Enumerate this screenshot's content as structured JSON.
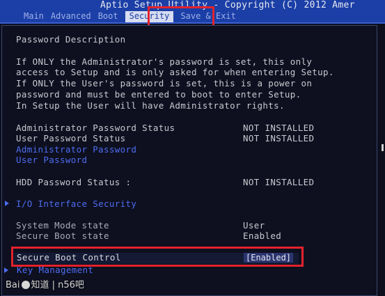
{
  "app": {
    "title": "Aptio Setup Utility - Copyright (C) 2012 Amer"
  },
  "tabs": [
    {
      "label": "Main",
      "active": false
    },
    {
      "label": "Advanced",
      "active": false
    },
    {
      "label": "Boot",
      "active": false
    },
    {
      "label": "Security",
      "active": true
    },
    {
      "label": "Save & Exit",
      "active": false
    }
  ],
  "security": {
    "section_title": "Password Description",
    "description_lines": [
      "If ONLY the Administrator's password is set, this only",
      "access to Setup and is only asked for when entering Setup.",
      "If ONLY the User's password is set, this is a power on",
      "password and must be entered to boot to enter Setup.",
      "In Setup the User will have Administrator rights."
    ],
    "admin_status_label": "Administrator Password Status",
    "admin_status_value": "NOT INSTALLED",
    "user_status_label": "User Password Status",
    "user_status_value": "NOT INSTALLED",
    "admin_password_link": "Administrator Password",
    "user_password_link": "User Password",
    "hdd_status_label": "HDD Password Status  :",
    "hdd_status_value": "NOT INSTALLED",
    "io_security_label": "I/O Interface Security",
    "system_mode_label": "System Mode state",
    "system_mode_value": "User",
    "secure_boot_state_label": "Secure Boot state",
    "secure_boot_state_value": "Enabled",
    "secure_boot_control_label": "Secure Boot Control",
    "secure_boot_control_value": "[Enabled]",
    "key_management_label": "Key Management"
  },
  "watermark": {
    "text_left": "Bai",
    "text_right": "知道 | n56吧"
  },
  "colors": {
    "header_blue": "#1b3fa7",
    "link_blue": "#4d6cf0",
    "highlight_red": "#e3222c",
    "text_gray": "#c8c9cf"
  }
}
